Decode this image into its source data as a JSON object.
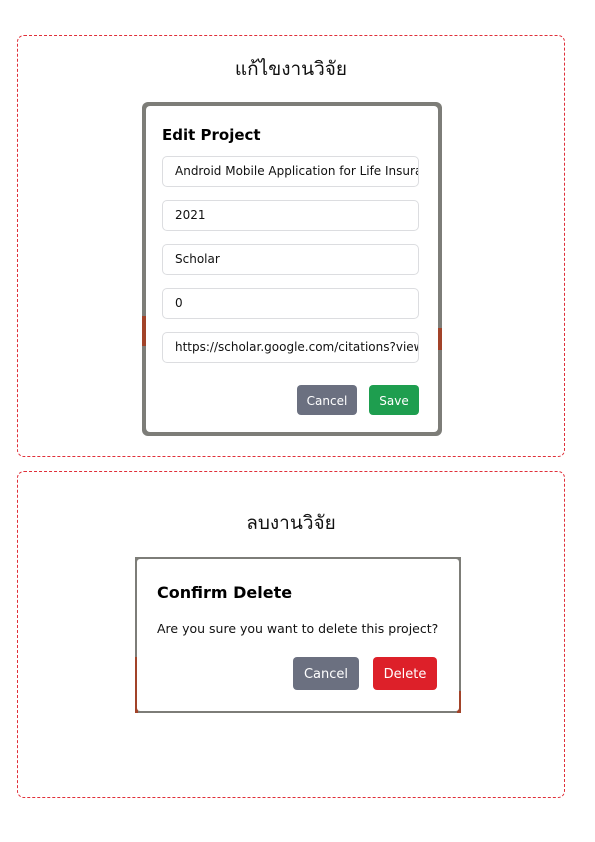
{
  "edit_section": {
    "title": "แก้ไขงานวิจัย",
    "modal": {
      "heading": "Edit Project",
      "fields": [
        "Android Mobile Application for Life Insuran",
        "2021",
        "Scholar",
        "0",
        "https://scholar.google.com/citations?view_c"
      ],
      "cancel_label": "Cancel",
      "save_label": "Save"
    }
  },
  "delete_section": {
    "title": "ลบงานวิจัย",
    "modal": {
      "heading": "Confirm Delete",
      "message": "Are you sure you want to delete this project?",
      "cancel_label": "Cancel",
      "delete_label": "Delete"
    }
  },
  "colors": {
    "section_border": "#e0303a",
    "cancel_button": "#6b7080",
    "save_button": "#1e9e4f",
    "delete_button": "#dd2029",
    "backdrop": "#7d7d78"
  }
}
